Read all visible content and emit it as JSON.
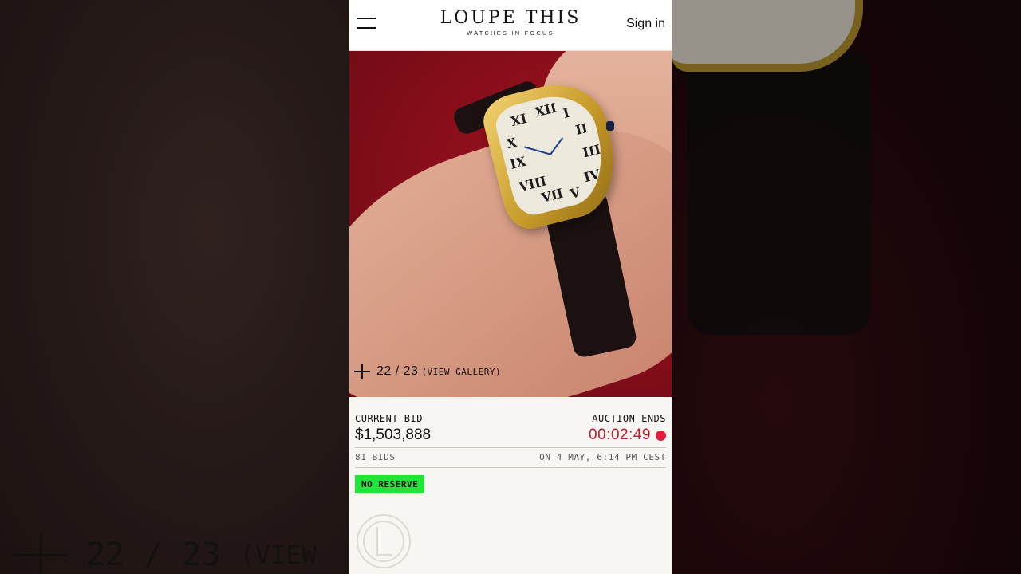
{
  "header": {
    "logo_title": "LOUPE THIS",
    "logo_subtitle": "WATCHES IN FOCUS",
    "signin_label": "Sign in",
    "menu_icon": "hamburger-icon"
  },
  "gallery": {
    "counter": "22 / 23",
    "label": "(VIEW GALLERY)",
    "icon": "plus-icon"
  },
  "side_panel": {
    "counter": "22 / 23",
    "label": "(VIEW"
  },
  "auction": {
    "current_bid_label": "CURRENT BID",
    "current_bid": "$1,503,888",
    "ends_label": "AUCTION ENDS",
    "countdown": "00:02:49",
    "bids": "81 BIDS",
    "ends_on": "ON 4 MAY, 6:14 PM CEST",
    "reserve_badge": "NO RESERVE"
  },
  "colors": {
    "accent_red": "#c01a2e",
    "live_dot": "#e21b3a",
    "badge_green": "#22e33a",
    "panel_bg": "#f8f6f2"
  }
}
